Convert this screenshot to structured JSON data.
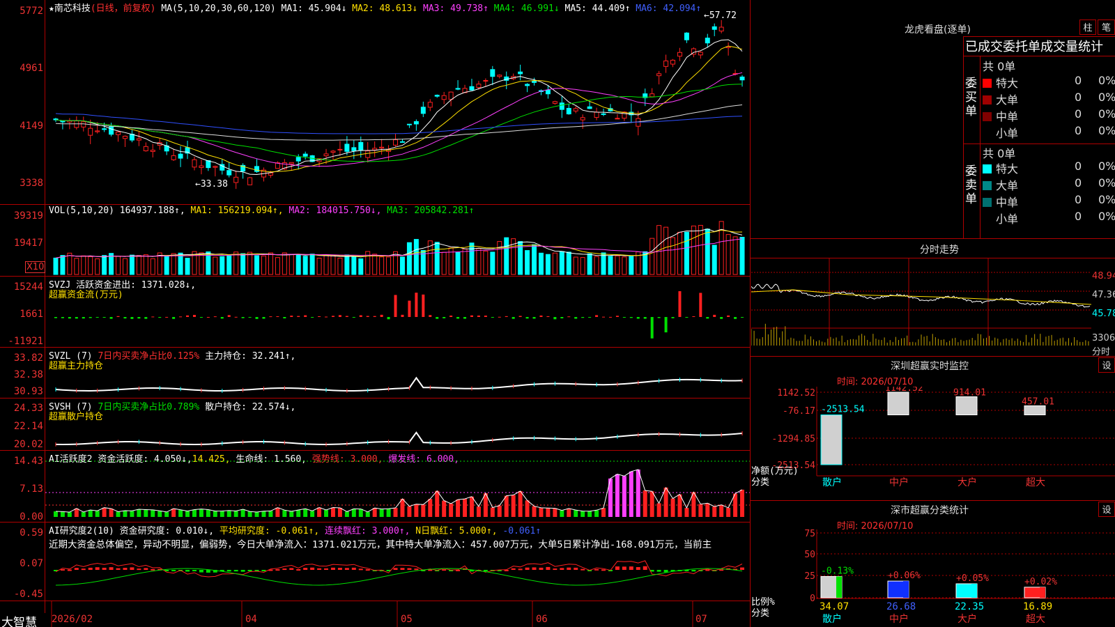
{
  "app": {
    "brand": "大智慧"
  },
  "main": {
    "star": "★",
    "stock_name": "南芯科技",
    "mode": "(日线，前复权)",
    "ma_head": "MA(5,10,20,30,60,120)",
    "ma": [
      {
        "label": "MA1: 45.904↓",
        "color": "#ffffff"
      },
      {
        "label": "MA2: 48.613↓",
        "color": "#ffe000"
      },
      {
        "label": "MA3: 49.738↑",
        "color": "#ff40ff"
      },
      {
        "label": "MA4: 46.991↓",
        "color": "#00e000"
      },
      {
        "label": "MA5: 44.409↑",
        "color": "#ffffff"
      },
      {
        "label": "MA6: 42.094↑",
        "color": "#4060ff"
      }
    ],
    "yticks": [
      "5772",
      "4961",
      "4149",
      "3338"
    ],
    "high_label": "57.72",
    "low_label": "33.38"
  },
  "vol": {
    "head": "VOL(5,10,20)",
    "value": "164937.188↑,",
    "ma1": "MA1: 156219.094↑,",
    "ma2": "MA2: 184015.750↓,",
    "ma3": "MA3: 205842.281↑",
    "yticks": [
      "39319",
      "19417"
    ],
    "unit": "X10"
  },
  "svzj": {
    "head": "SVZJ",
    "label": "活跃资金进出: 1371.028↓,",
    "sub": "超赢资金流(万元)",
    "yticks": [
      "15244",
      "1661",
      "-11921"
    ]
  },
  "svzl": {
    "head": "SVZL (7)",
    "pct": "7日内买卖净占比0.125%",
    "label": "主力持仓: 32.241↑,",
    "sub": "超赢主力持仓",
    "yticks": [
      "33.82",
      "32.38",
      "30.93"
    ]
  },
  "svsh": {
    "head": "SVSH (7)",
    "pct": "7日内买卖净占比0.789%",
    "label": "散户持仓: 22.574↓,",
    "sub": "超赢散户持仓",
    "yticks": [
      "24.33",
      "22.14",
      "20.02"
    ]
  },
  "ai1": {
    "head": "AI活跃度2",
    "label1": "资金活跃度: 4.050↓,",
    "label2": "14.425,",
    "label3": "生命线: 1.560,",
    "label4": "强势线: 3.000,",
    "label5": "爆发线: 6.000,",
    "yticks": [
      "14.43",
      "7.13",
      "0.00"
    ]
  },
  "ai2": {
    "head": "AI研究度2(10)",
    "label1": "资金研究度: 0.010↓,",
    "label2": "平均研究度: -0.061↑,",
    "label3": "连续飘红: 3.000↑,",
    "label4": "N日飘红: 5.000↑,",
    "label5": "-0.061↑",
    "text": "近期大资金总体偏空，异动不明显，偏弱势，今日大单净流入：1371.021万元，其中特大单净流入：457.007万元，大单5日累计净出-168.091万元，当前主",
    "yticks": [
      "0.59",
      "0.07",
      "-0.45"
    ]
  },
  "xaxis": [
    "2026/02",
    "04",
    "05",
    "06",
    "07"
  ],
  "right": {
    "lhb_title": "龙虎看盘(逐单)",
    "btn1": "柱",
    "btn2": "笔",
    "stats_title": "已成交委托单成交量统计",
    "buy_label": "委买单",
    "sell_label": "委卖单",
    "buy_total": "共 0单",
    "sell_total": "共 0单",
    "buy_rows": [
      {
        "name": "特大",
        "count": "0",
        "pct": "0%",
        "color": "#ff0000"
      },
      {
        "name": "大单",
        "count": "0",
        "pct": "0%",
        "color": "#a00000"
      },
      {
        "name": "中单",
        "count": "0",
        "pct": "0%",
        "color": "#800000"
      },
      {
        "name": "小单",
        "count": "0",
        "pct": "0%",
        "color": "#000000"
      }
    ],
    "sell_rows": [
      {
        "name": "特大",
        "count": "0",
        "pct": "0%",
        "color": "#00ffff"
      },
      {
        "name": "大单",
        "count": "0",
        "pct": "0%",
        "color": "#008888"
      },
      {
        "name": "中单",
        "count": "0",
        "pct": "0%",
        "color": "#007070"
      },
      {
        "name": "小单",
        "count": "0",
        "pct": "0%",
        "color": "#000000"
      }
    ],
    "intraday_title": "分时走势",
    "intraday_yticks": [
      "48.94",
      "47.36",
      "45.78",
      "3306"
    ],
    "intraday_bottom": "分时",
    "sz_title": "深圳超赢实时监控",
    "sz_btn": "设",
    "sz_time": "时间: 2026/07/10",
    "sz_yticks": [
      "1142.52",
      "-76.17",
      "-1294.85",
      "-2513.54"
    ],
    "sz_ylabel": "净额(万元)",
    "sz_xlabel": "分类",
    "sz_cats": [
      "散户",
      "中户",
      "大户",
      "超大"
    ],
    "sz_values": [
      -2513.54,
      1142.52,
      914.01,
      457.01
    ],
    "sz_value_labels": [
      "-2513.54",
      "1142.52",
      "914.01",
      "457.01"
    ],
    "cls_title": "深市超赢分类统计",
    "cls_btn": "设",
    "cls_time": "时间: 2026/07/10",
    "cls_yticks": [
      "75",
      "50",
      "25",
      "0"
    ],
    "cls_ylabel": "比例%",
    "cls_xlabel": "分类",
    "cls_cats": [
      "散户",
      "中户",
      "大户",
      "超大"
    ],
    "cls_values": [
      34.07,
      26.68,
      22.35,
      16.89
    ],
    "cls_value_labels": [
      "34.07",
      "26.68",
      "22.35",
      "16.89"
    ],
    "cls_change_labels": [
      "-0.13%",
      "+0.06%",
      "+0.05%",
      "+0.02%"
    ]
  },
  "chart_data": {
    "type": "candlestick",
    "ylim": [
      33.38,
      57.72
    ],
    "n_days": 100,
    "x_ticks": [
      "2026/02",
      "04",
      "05",
      "06",
      "07"
    ],
    "series": [
      {
        "name": "MA1",
        "color": "#ffffff"
      },
      {
        "name": "MA2",
        "color": "#ffe000"
      },
      {
        "name": "MA3",
        "color": "#ff40ff"
      },
      {
        "name": "MA4",
        "color": "#00e000"
      },
      {
        "name": "MA5",
        "color": "#ffffff"
      },
      {
        "name": "MA6",
        "color": "#4060ff"
      }
    ]
  }
}
